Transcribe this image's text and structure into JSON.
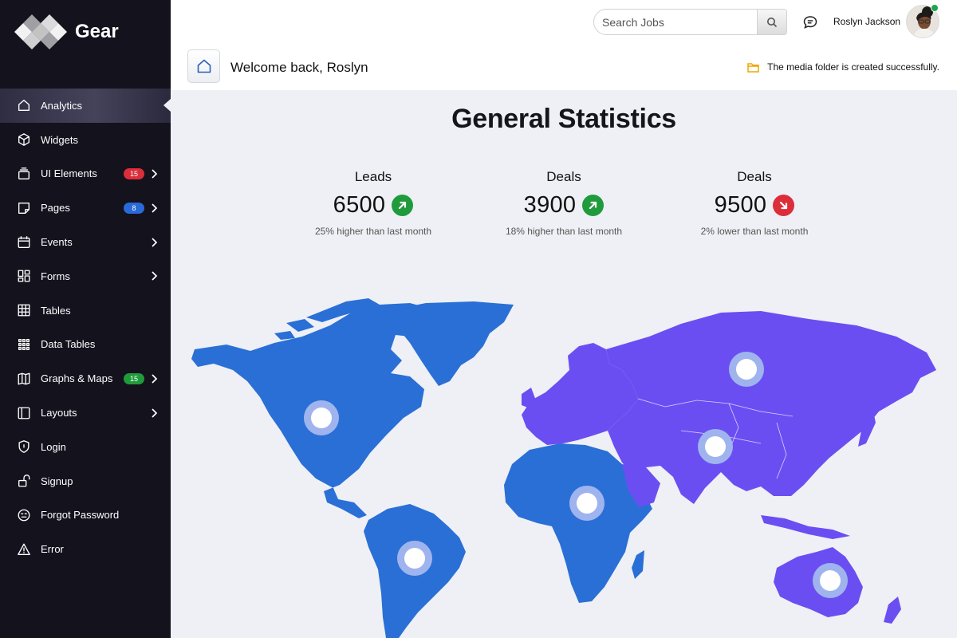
{
  "brand": {
    "name": "Gear"
  },
  "sidebar": {
    "items": [
      {
        "label": "Analytics",
        "icon": "home-icon",
        "active": true
      },
      {
        "label": "Widgets",
        "icon": "cube-icon"
      },
      {
        "label": "UI Elements",
        "icon": "layers-icon",
        "badge": "15",
        "badge_color": "#dc2d3a",
        "chevron": true
      },
      {
        "label": "Pages",
        "icon": "pages-icon",
        "badge": "8",
        "badge_color": "#2a6ad8",
        "chevron": true
      },
      {
        "label": "Events",
        "icon": "calendar-icon",
        "chevron": true
      },
      {
        "label": "Forms",
        "icon": "forms-grid-icon",
        "chevron": true
      },
      {
        "label": "Tables",
        "icon": "table-icon"
      },
      {
        "label": "Data Tables",
        "icon": "dots-grid-icon"
      },
      {
        "label": "Graphs & Maps",
        "icon": "map-icon",
        "badge": "15",
        "badge_color": "#1f9b3b",
        "chevron": true
      },
      {
        "label": "Layouts",
        "icon": "layout-icon",
        "chevron": true
      },
      {
        "label": "Login",
        "icon": "shield-icon"
      },
      {
        "label": "Signup",
        "icon": "unlock-icon"
      },
      {
        "label": "Forgot Password",
        "icon": "neutral-face-icon"
      },
      {
        "label": "Error",
        "icon": "warning-icon"
      }
    ]
  },
  "header": {
    "search_placeholder": "Search Jobs",
    "user_name": "Roslyn Jackson",
    "welcome": "Welcome back, Roslyn",
    "notice": "The media folder is created successfully."
  },
  "main": {
    "title": "General Statistics",
    "stats": [
      {
        "label": "Leads",
        "value": "6500",
        "trend": "up",
        "note": "25% higher than last month"
      },
      {
        "label": "Deals",
        "value": "3900",
        "trend": "up",
        "note": "18% higher than last month"
      },
      {
        "label": "Deals",
        "value": "9500",
        "trend": "down",
        "note": "2% lower than last month"
      }
    ],
    "map_regions": [
      {
        "region": "north-america",
        "color": "#2a6fd6"
      },
      {
        "region": "south-america",
        "color": "#2a6fd6"
      },
      {
        "region": "africa",
        "color": "#2a6fd6"
      },
      {
        "region": "europe",
        "color": "#6b4ef2"
      },
      {
        "region": "asia",
        "color": "#6b4ef2"
      },
      {
        "region": "oceania",
        "color": "#6b4ef2"
      }
    ]
  },
  "colors": {
    "sidebar_bg": "#13121d",
    "trend_up": "#1f9b3b",
    "trend_down": "#dc2d3a",
    "accent": "#2a6fd6",
    "accent2": "#6b4ef2"
  }
}
